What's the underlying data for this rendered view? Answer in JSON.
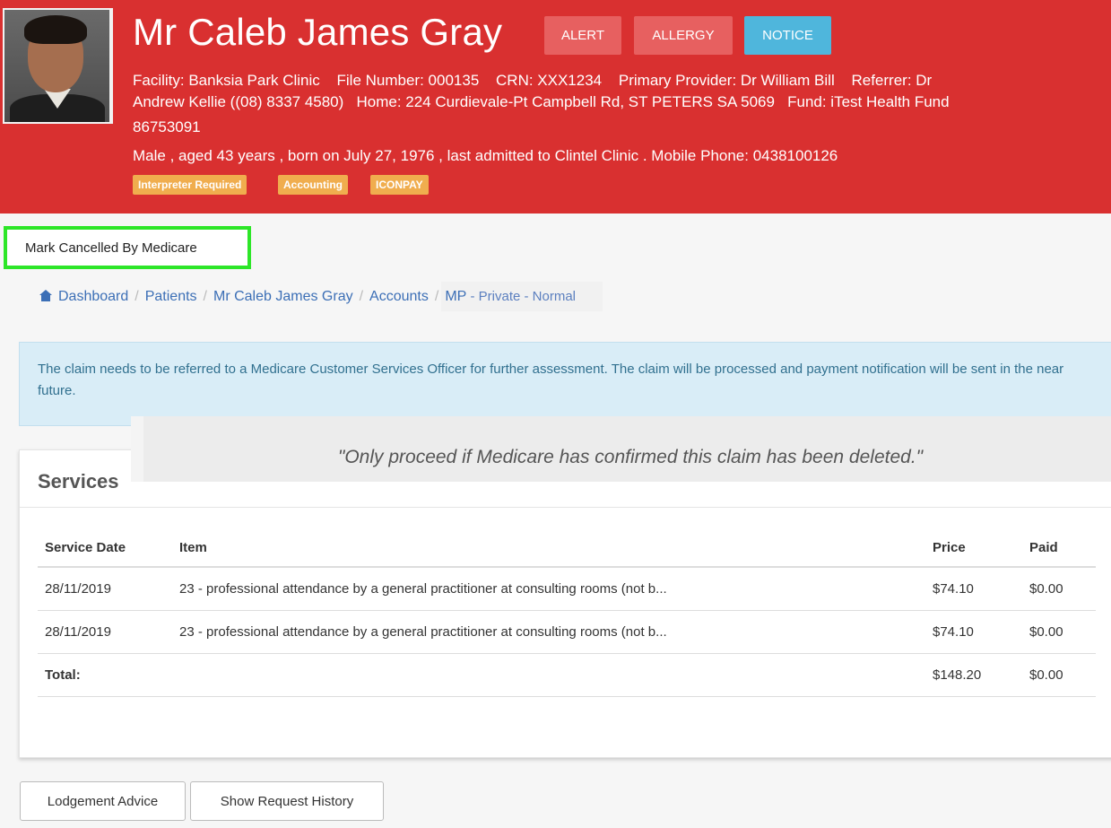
{
  "patient": {
    "name": "Mr Caleb James Gray",
    "buttons": {
      "alert": "ALERT",
      "allergy": "ALLERGY",
      "notice": "NOTICE"
    },
    "facility": "Facility: Banksia Park Clinic",
    "file_number": "File Number: 000135",
    "crn": "CRN: XXX1234",
    "primary_provider": "Primary Provider: Dr William Bill",
    "referrer": "Referrer: Dr",
    "line2": "Andrew Kellie ((08) 8337 4580)   Home: 224 Curdievale-Pt Campbell Rd, ST PETERS SA 5069   Fund: iTest Health Fund",
    "line3": "86753091",
    "line4": "Male , aged 43 years , born on July 27, 1976 , last admitted to Clintel Clinic . Mobile Phone: 0438100126",
    "tags": [
      "Interpreter Required",
      "Accounting",
      "ICONPAY"
    ]
  },
  "actions": {
    "mark_cancelled": "Mark Cancelled By Medicare"
  },
  "breadcrumb": {
    "dashboard": "Dashboard",
    "patients": "Patients",
    "patient": "Mr Caleb James Gray",
    "accounts": "Accounts",
    "mp": "MP",
    "rest": " - Private - Normal",
    "separator": "/"
  },
  "info_alert": "The claim needs to be referred to a Medicare Customer Services Officer for further assessment. The claim will be processed and payment notification will be sent in the near future.",
  "quote": "\"Only proceed if Medicare has confirmed this claim has been deleted.\"",
  "services": {
    "title": "Services",
    "columns": [
      "Service Date",
      "Item",
      "Price",
      "Paid"
    ],
    "rows": [
      {
        "date": "28/11/2019",
        "item": "23 - professional attendance by a general practitioner at consulting rooms (not b...",
        "price": "$74.10",
        "paid": "$0.00"
      },
      {
        "date": "28/11/2019",
        "item": "23 - professional attendance by a general practitioner at consulting rooms (not b...",
        "price": "$74.10",
        "paid": "$0.00"
      }
    ],
    "total": {
      "label": "Total:",
      "price": "$148.20",
      "paid": "$0.00"
    }
  },
  "bottom_buttons": {
    "lodgement": "Lodgement Advice",
    "history": "Show Request History"
  },
  "colors": {
    "header_red": "#d93030",
    "alert_btn": "#e76060",
    "notice_btn": "#4fb6dc",
    "tag": "#f0ad4e",
    "link": "#3c6fb6",
    "highlight": "#2de628"
  },
  "icons": {
    "home": "home-icon"
  }
}
